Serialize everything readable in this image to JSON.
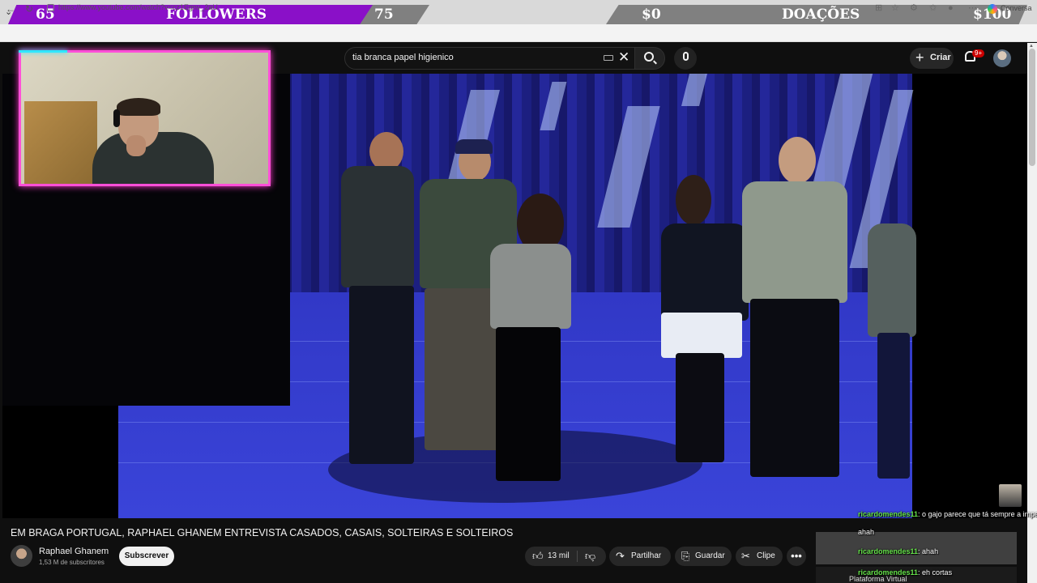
{
  "goal_followers": {
    "current": "65",
    "label": "FOLLOWERS",
    "target": "75"
  },
  "goal_donations": {
    "current": "$0",
    "label": "DOAÇÕES",
    "target": "$100"
  },
  "browser": {
    "url": "https://www.youtube.com/watch?v=cz1Egnv_2aU",
    "copilot_label": "Conversa"
  },
  "youtube": {
    "search_value": "tia branca papel higienico",
    "create_label": "Criar",
    "notification_count": "9+"
  },
  "video": {
    "title": "EM BRAGA PORTUGAL, RAPHAEL GHANEM ENTREVISTA CASADOS, CASAIS, SOLTEIRAS E SOLTEIROS",
    "channel_name": "Raphael Ghanem",
    "subscribers": "1,53 M de subscritores",
    "subscribe_label": "Subscrever",
    "likes": "13 mil",
    "share_label": "Partilhar",
    "save_label": "Guardar",
    "clip_label": "Clipe",
    "more_label": "•••"
  },
  "chat": [
    {
      "user": "ricardomendes11",
      "text": ": o gajo parece que tá sempre a impedir que ela leve um tiro"
    },
    {
      "user": "",
      "text": "ahah"
    },
    {
      "user": "ricardomendes11",
      "text": ": ahah"
    },
    {
      "user": "ricardomendes11",
      "text": ": eh cortas"
    }
  ],
  "bottom_snippet": "Plataforma Virtual",
  "colors": {
    "goal_purple": "#8a10c8",
    "cam_border": "#ff4fd8",
    "cam_glow": "#31e6ff",
    "chat_user": "#65e24a",
    "stage_blue": "#3440d2"
  }
}
